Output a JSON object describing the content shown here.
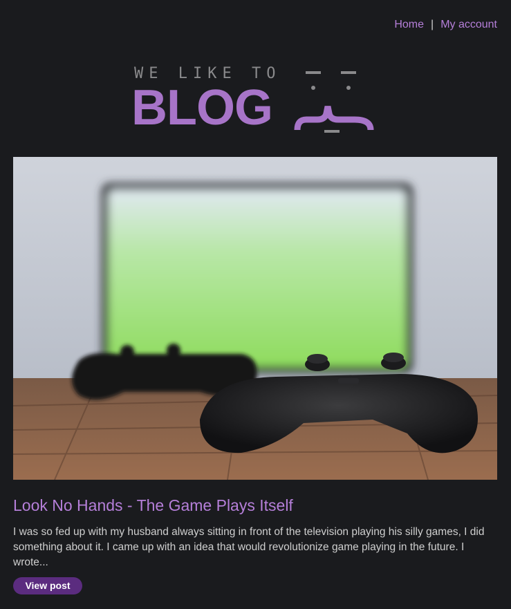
{
  "nav": {
    "home": "Home",
    "separator": "|",
    "account": "My account"
  },
  "logo": {
    "tagline": "WE LIKE TO",
    "name": "BLOG"
  },
  "post": {
    "title": "Look No Hands - The Game Plays Itself",
    "excerpt": "I was so fed up with my husband always sitting in front of the television playing his silly games, I did something about it. I came up with an idea that would revolutionize game playing in the future. I wrote...",
    "button_label": "View post"
  },
  "colors": {
    "background": "#1a1b1e",
    "accent": "#b57fd9",
    "logo": "#a774c8",
    "button": "#5b2c7f"
  }
}
